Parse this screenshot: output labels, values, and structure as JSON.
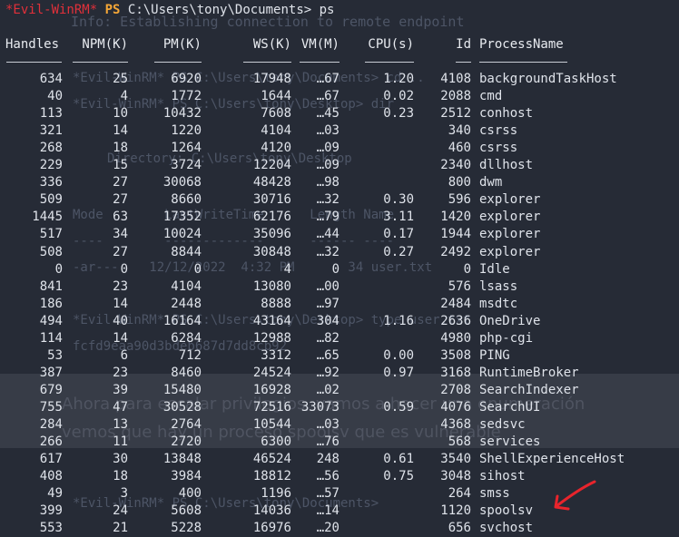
{
  "ghost": {
    "lines": [
      "Info: Establishing connection to remote endpoint",
      "*Evil-WinRM* PS C:\\Users\\tony\\Documents> cd ..",
      "*Evil-WinRM* PS C:\\Users\\tony\\Desktop> dir",
      "Directory: C:\\Users\\tony\\Desktop",
      "Mode        LastWriteTime      Length Name",
      "----        -------------      ------ ----",
      "-ar---    12/12/2022  4:32 PM       34 user.txt",
      "*Evil-WinRM* PS C:\\Users\\tony\\Desktop> type user.txt",
      "fcfd9eaa90d3bdeb687d7dd8cb92",
      "*Evil-WinRM* PS C:\\Users\\tony\\Documents> "
    ],
    "spanish_1": "Ahora para escalar privilegios, vamos a hacer una enumeración",
    "spanish_2": "vemos que hay un proceso spoolsv que es vulnerable"
  },
  "prompt": {
    "user": "*Evil-WinRM*",
    "ps": "PS",
    "path": "C:\\Users\\tony\\Documents>",
    "command": "ps"
  },
  "headers": [
    "Handles",
    "NPM(K)",
    "PM(K)",
    "WS(K)",
    "VM(M)",
    "CPU(s)",
    "Id",
    "ProcessName"
  ],
  "dashes": [
    "-------",
    "------",
    "-----",
    "-----",
    "-----",
    "------",
    "--",
    "-----------"
  ],
  "rows": [
    [
      "634",
      "25",
      "6920",
      "17948",
      "…67",
      "1.20",
      "4108",
      "backgroundTaskHost"
    ],
    [
      "40",
      "4",
      "1772",
      "1644",
      "…67",
      "0.02",
      "2088",
      "cmd"
    ],
    [
      "113",
      "10",
      "10432",
      "7608",
      "…45",
      "0.23",
      "2512",
      "conhost"
    ],
    [
      "321",
      "14",
      "1220",
      "4104",
      "…03",
      "",
      "340",
      "csrss"
    ],
    [
      "268",
      "18",
      "1264",
      "4120",
      "…09",
      "",
      "460",
      "csrss"
    ],
    [
      "229",
      "15",
      "3724",
      "12204",
      "…09",
      "",
      "2340",
      "dllhost"
    ],
    [
      "336",
      "27",
      "30068",
      "48428",
      "…98",
      "",
      "800",
      "dwm"
    ],
    [
      "509",
      "27",
      "8660",
      "30716",
      "…32",
      "0.30",
      "596",
      "explorer"
    ],
    [
      "1445",
      "63",
      "17352",
      "62176",
      "…79",
      "3.11",
      "1420",
      "explorer"
    ],
    [
      "517",
      "34",
      "10024",
      "35096",
      "…44",
      "0.17",
      "1944",
      "explorer"
    ],
    [
      "508",
      "27",
      "8844",
      "30848",
      "…32",
      "0.27",
      "2492",
      "explorer"
    ],
    [
      "0",
      "0",
      "0",
      "4",
      "0",
      "",
      "0",
      "Idle"
    ],
    [
      "841",
      "23",
      "4104",
      "13080",
      "…00",
      "",
      "576",
      "lsass"
    ],
    [
      "186",
      "14",
      "2448",
      "8888",
      "…97",
      "",
      "2484",
      "msdtc"
    ],
    [
      "494",
      "40",
      "16164",
      "43164",
      "304",
      "1.16",
      "2636",
      "OneDrive"
    ],
    [
      "114",
      "14",
      "6284",
      "12988",
      "…82",
      "",
      "4980",
      "php-cgi"
    ],
    [
      "53",
      "6",
      "712",
      "3312",
      "…65",
      "0.00",
      "3508",
      "PING"
    ],
    [
      "387",
      "23",
      "8460",
      "24524",
      "…92",
      "0.97",
      "3168",
      "RuntimeBroker"
    ],
    [
      "679",
      "39",
      "15480",
      "16928",
      "…02",
      "",
      "2708",
      "SearchIndexer"
    ],
    [
      "755",
      "47",
      "30528",
      "72516",
      "33073",
      "0.59",
      "4076",
      "SearchUI"
    ],
    [
      "284",
      "13",
      "2764",
      "10544",
      "…03",
      "",
      "4368",
      "sedsvc"
    ],
    [
      "266",
      "11",
      "2720",
      "6300",
      "…76",
      "",
      "568",
      "services"
    ],
    [
      "617",
      "30",
      "13848",
      "46524",
      "248",
      "0.61",
      "3540",
      "ShellExperienceHost"
    ],
    [
      "408",
      "18",
      "3984",
      "18812",
      "…56",
      "0.75",
      "3048",
      "sihost"
    ],
    [
      "49",
      "3",
      "400",
      "1196",
      "…57",
      "",
      "264",
      "smss"
    ],
    [
      "399",
      "24",
      "5608",
      "14036",
      "…14",
      "",
      "1120",
      "spoolsv"
    ],
    [
      "553",
      "21",
      "5228",
      "16976",
      "…20",
      "",
      "656",
      "svchost"
    ]
  ],
  "colors": {
    "background": "#262b36",
    "prompt_user": "#e0303a",
    "prompt_ps": "#f4a637",
    "text": "#dfe3ea",
    "annotation_arrow": "#e8242c"
  },
  "annotation": {
    "icon": "red-arrow-icon"
  }
}
